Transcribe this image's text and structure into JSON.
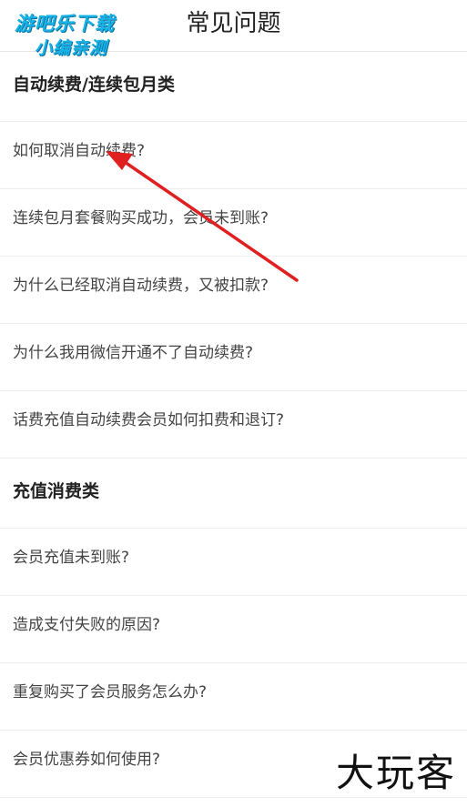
{
  "header": {
    "title": "常见问题"
  },
  "watermark": {
    "top_line1": "游吧乐下载",
    "top_line2": "小编亲测",
    "bottom": "大玩客"
  },
  "sections": [
    {
      "title": "自动续费/连续包月类",
      "items": [
        "如何取消自动续费?",
        "连续包月套餐购买成功，会员未到账?",
        "为什么已经取消自动续费，又被扣款?",
        "为什么我用微信开通不了自动续费?",
        "话费充值自动续费会员如何扣费和退订?"
      ]
    },
    {
      "title": "充值消费类",
      "items": [
        "会员充值未到账?",
        "造成支付失败的原因?",
        "重复购买了会员服务怎么办?",
        "会员优惠券如何使用?"
      ]
    }
  ],
  "colors": {
    "arrow": "#e02020",
    "watermark_blue": "#19b3e6"
  }
}
